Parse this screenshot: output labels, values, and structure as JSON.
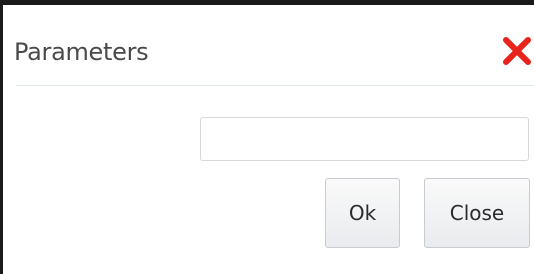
{
  "dialog": {
    "title": "Parameters",
    "close_icon": "close-x-icon",
    "close_icon_color": "#e8231b"
  },
  "form": {
    "parameter_value": "",
    "parameter_placeholder": ""
  },
  "buttons": {
    "ok_label": "Ok",
    "close_label": "Close"
  }
}
